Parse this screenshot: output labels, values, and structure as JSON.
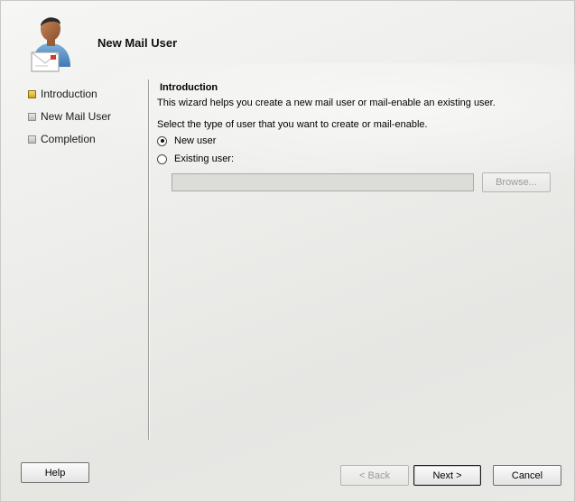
{
  "header": {
    "title": "New Mail User",
    "icon": "mail-user-icon"
  },
  "nav": {
    "items": [
      {
        "label": "Introduction",
        "state": "current",
        "color": "#e0b63a"
      },
      {
        "label": "New Mail User",
        "state": "pending",
        "color": "#b9b9b9"
      },
      {
        "label": "Completion",
        "state": "pending",
        "color": "#b9b9b9"
      }
    ]
  },
  "content": {
    "section_title": "Introduction",
    "intro_text": "This wizard helps you create a new mail user or mail-enable an existing user.",
    "select_prompt": "Select the type of user that you want to create or mail-enable.",
    "options": [
      {
        "label": "New user",
        "checked": true
      },
      {
        "label": "Existing user:",
        "checked": false
      }
    ],
    "existing_user_value": "",
    "browse_label": "Browse..."
  },
  "footer": {
    "help_label": "Help",
    "back_label": "< Back",
    "next_label": "Next >",
    "cancel_label": "Cancel"
  }
}
